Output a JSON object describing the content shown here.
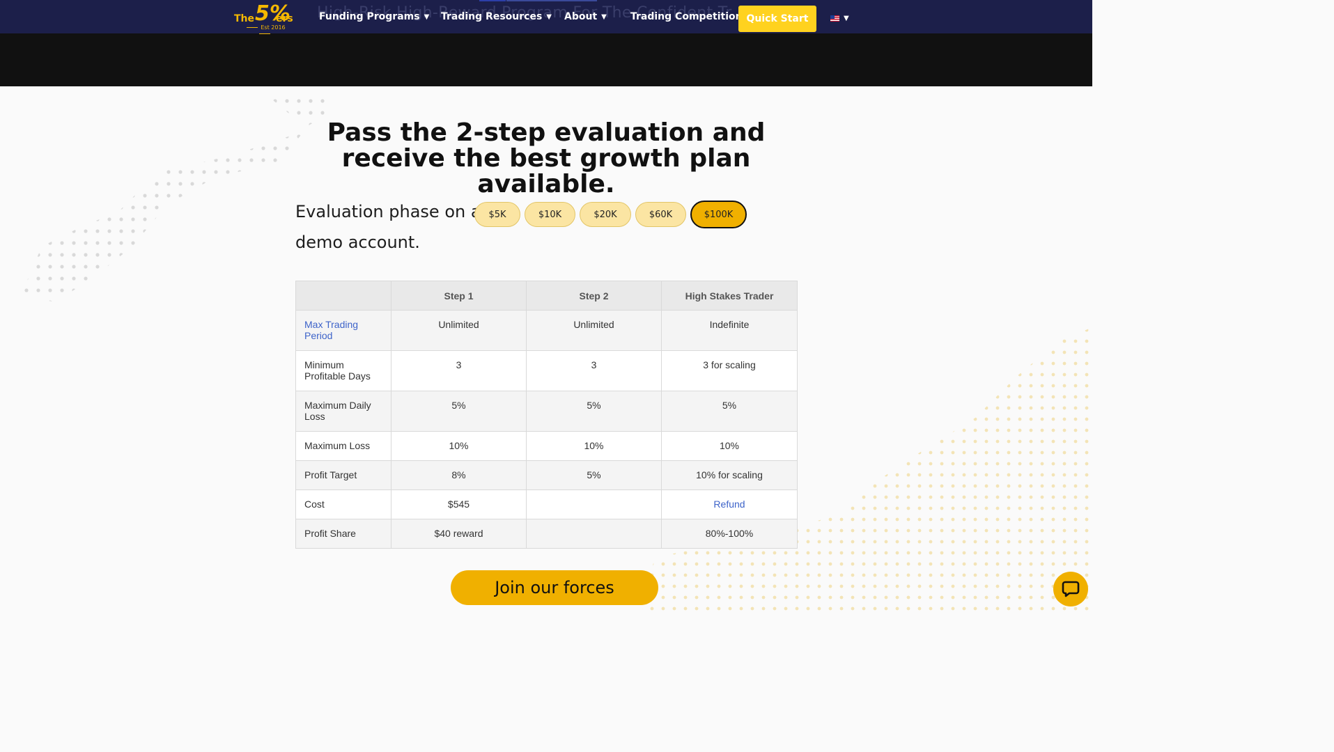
{
  "header": {
    "logo": {
      "the": "The",
      "five": "5%",
      "ers": "ers",
      "est": "Est 2016"
    },
    "background_headline": "High-Risk High-Reward Program For The Confident Tr",
    "nav": [
      {
        "label": "Funding Programs",
        "dropdown": true
      },
      {
        "label": "Trading Resources",
        "dropdown": true
      },
      {
        "label": "About",
        "dropdown": true
      },
      {
        "label": "Trading Competition",
        "dropdown": false
      }
    ],
    "quick_start": "Quick Start",
    "language_flag": "us-flag"
  },
  "main": {
    "headline": "Pass the 2-step evaluation and receive the best growth plan available.",
    "eval_prefix": "Evaluation phase on a",
    "eval_suffix": "demo account.",
    "account_sizes": [
      "$5K",
      "$10K",
      "$20K",
      "$60K",
      "$100K"
    ],
    "selected_size": "$100K",
    "table": {
      "headers": [
        "",
        "Step 1",
        "Step 2",
        "High Stakes Trader"
      ],
      "rows": [
        [
          "Max Trading Period",
          "Unlimited",
          "Unlimited",
          "Indefinite"
        ],
        [
          "Minimum Profitable Days",
          "3",
          "3",
          "3 for scaling"
        ],
        [
          "Maximum Daily Loss",
          "5%",
          "5%",
          "5%"
        ],
        [
          "Maximum Loss",
          "10%",
          "10%",
          "10%"
        ],
        [
          "Profit Target",
          "8%",
          "5%",
          "10% for scaling"
        ],
        [
          "Cost",
          "$545",
          "",
          "Refund"
        ],
        [
          "Profit Share",
          "$40 reward",
          "",
          "80%-100%"
        ]
      ]
    },
    "cta": "Join our forces"
  },
  "colors": {
    "nav_bg": "#1c1f4a",
    "accent": "#f0b000",
    "quick_start_bg": "#ffd21f",
    "pill_bg": "#fbe5a3",
    "link": "#3d63c9"
  },
  "icons": {
    "chat": "chat-bubble-icon",
    "caret": "chevron-down-icon"
  }
}
